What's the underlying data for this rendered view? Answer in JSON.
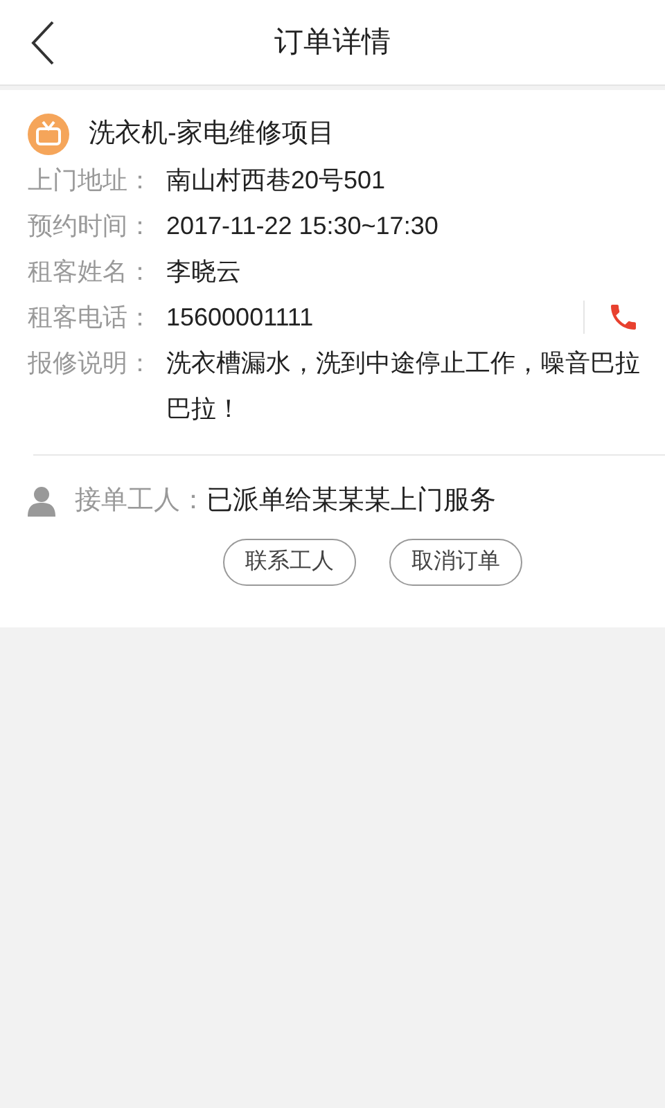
{
  "header": {
    "title": "订单详情"
  },
  "order": {
    "project": "洗衣机-家电维修项目",
    "fields": [
      {
        "kind": "text",
        "label": "上门地址：",
        "value": "南山村西巷20号501"
      },
      {
        "kind": "text",
        "label": "预约时间：",
        "value": "2017-11-22  15:30~17:30"
      },
      {
        "kind": "text",
        "label": "租客姓名：",
        "value": "李晓云"
      },
      {
        "kind": "phone",
        "label": "租客电话：",
        "value": "15600001111"
      },
      {
        "kind": "text",
        "label": "报修说明：",
        "value": "洗衣槽漏水，洗到中途停止工作，噪音巴拉巴拉！"
      }
    ]
  },
  "worker": {
    "label": "接单工人：",
    "value": "已派单给某某某上门服务"
  },
  "buttons": [
    "联系工人",
    "取消订单"
  ]
}
